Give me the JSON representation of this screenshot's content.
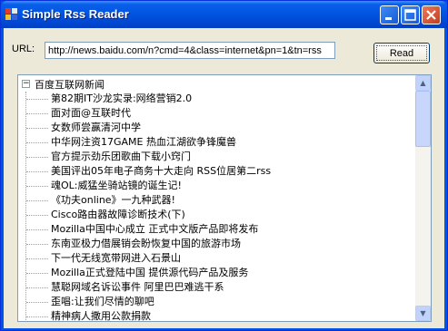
{
  "window": {
    "title": "Simple Rss Reader",
    "icon": "app-icon",
    "controls": [
      "minimize-icon",
      "maximize-icon",
      "close-icon"
    ]
  },
  "form": {
    "url_label": "URL:",
    "url_value": "http://news.baidu.com/n?cmd=4&class=internet&pn=1&tn=rss",
    "read_button": "Read"
  },
  "tree": {
    "root_expander": "−",
    "root_label": "百度互联网新闻",
    "items": [
      "第82期IT沙龙实录:网络营销2.0",
      "面对面@互联时代",
      "女数师尝赢清河中学",
      "中华网注资17GAME 热血江湖欲争锋魔兽",
      "官方提示劲乐团歌曲下载小窍门",
      "美国评出05年电子商务十大走向 RSS位居第二rss",
      "魂OL:威猛坐骑站镜的诞生记!",
      "《功夫online》一九种武器!",
      "Cisco路由器故障诊断技术(下)",
      "Mozilla中国中心成立 正式中文版产品即将发布",
      "东南亚极力借展销会盼恢复中国的旅游市场",
      "下一代无线宽带网进入石景山",
      "Mozilla正式登陆中国 提供源代码产品及服务",
      "慧聪网域名诉讼事件 阿里巴巴难逃干系",
      "歪唱:让我们尽情的聊吧",
      "精神病人撒用公款捐款"
    ]
  },
  "colors": {
    "titlebar": "#0054e3",
    "client_background": "#ece9d8",
    "input_border": "#7f9db9",
    "scrollbar": "#c1d3fb"
  }
}
